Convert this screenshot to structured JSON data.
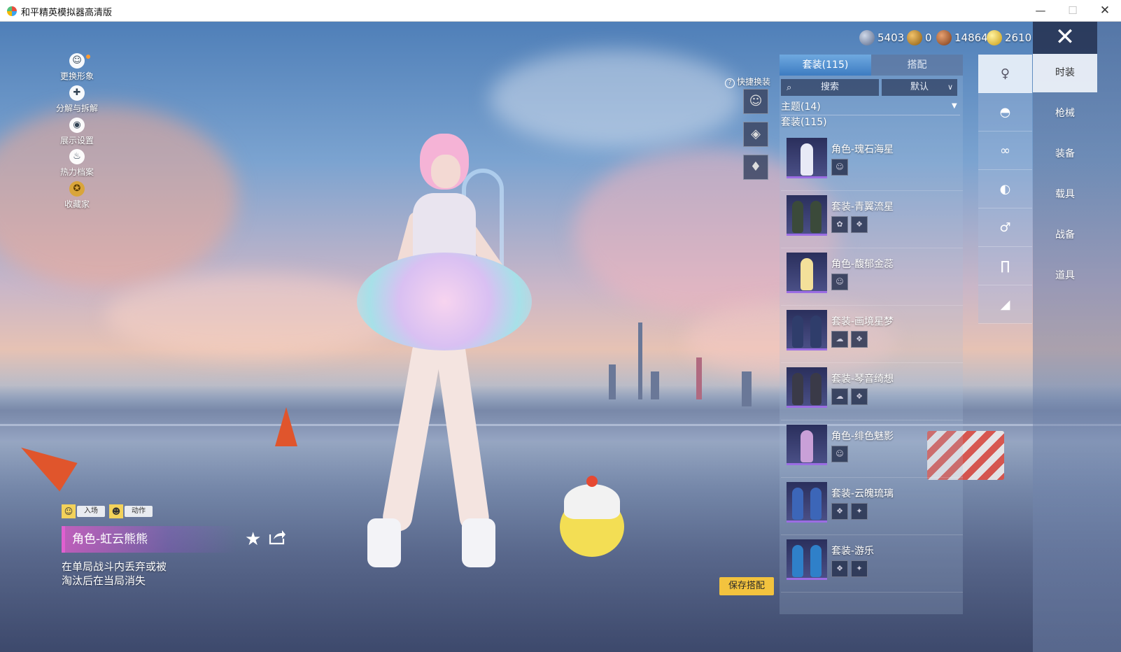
{
  "window": {
    "title": "和平精英模拟器高清版",
    "minimize": "—",
    "maximize": "☐",
    "close": "✕"
  },
  "left_menu": [
    {
      "label": "更换形象",
      "icon": "person-icon",
      "glyph": "☺"
    },
    {
      "label": "分解与拆解",
      "icon": "puzzle-icon",
      "glyph": "✚"
    },
    {
      "label": "展示设置",
      "icon": "eye-icon",
      "glyph": "◉"
    },
    {
      "label": "热力档案",
      "icon": "flame-icon",
      "glyph": "♨"
    },
    {
      "label": "收藏家",
      "icon": "collector-badge-icon",
      "glyph": "✪"
    }
  ],
  "mini_tabs": [
    {
      "label": "入场",
      "glyph": "☺"
    },
    {
      "label": "动作",
      "glyph": "☻"
    }
  ],
  "selected_item": {
    "name": "角色-虹云熊熊",
    "description": "在单局战斗内丢弃或被\n淘汰后在当局消失"
  },
  "save_button": "保存搭配",
  "currencies": [
    {
      "value": "5403",
      "icon": "globe-coin-icon",
      "color": "#8a9bb8"
    },
    {
      "value": "0",
      "icon": "bronze-coin-icon",
      "color": "#c08a2a"
    },
    {
      "value": "14864",
      "icon": "copper-coin-icon",
      "color": "#b06a3a"
    },
    {
      "value": "2610",
      "icon": "gold-coin-icon",
      "color": "#e8c23a"
    }
  ],
  "quick_switch": {
    "label": "快捷换装",
    "help": "?",
    "slots": [
      "☺",
      "◈",
      "♦"
    ]
  },
  "panel": {
    "tab_active": "套装(115)",
    "tab_inactive": "搭配",
    "search": "搜索",
    "sort": "默认",
    "theme_header": "主题(14)",
    "suit_header": "套装(115)"
  },
  "outfits": [
    {
      "name": "角色-瑰石海星",
      "subs": [
        "☺"
      ],
      "color": "#e8eaf6"
    },
    {
      "name": "套装-青翼流星",
      "subs": [
        "✿",
        "❖"
      ],
      "color": "#3b4a3a"
    },
    {
      "name": "角色-馥郁金蕊",
      "subs": [
        "☺"
      ],
      "color": "#f3e09a"
    },
    {
      "name": "套装-画境星梦",
      "subs": [
        "☁",
        "❖"
      ],
      "color": "#2f3d6b"
    },
    {
      "name": "套装-琴音绮想",
      "subs": [
        "☁",
        "❖"
      ],
      "color": "#3a3a48"
    },
    {
      "name": "角色-绯色魅影",
      "subs": [
        "☺"
      ],
      "color": "#c9a0d8"
    },
    {
      "name": "套装-云魄琉璃",
      "subs": [
        "❖",
        "✦"
      ],
      "color": "#3c66b8"
    },
    {
      "name": "套装-游乐",
      "subs": [
        "❖",
        "✦"
      ],
      "color": "#2f80c9"
    }
  ],
  "categories": [
    {
      "name": "outfit-category-icon",
      "glyph": "♀"
    },
    {
      "name": "cap-category-icon",
      "glyph": "◓"
    },
    {
      "name": "glasses-category-icon",
      "glyph": "∞"
    },
    {
      "name": "mask-category-icon",
      "glyph": "◐"
    },
    {
      "name": "top-category-icon",
      "glyph": "♂"
    },
    {
      "name": "pants-category-icon",
      "glyph": "∏"
    },
    {
      "name": "shoes-category-icon",
      "glyph": "◢"
    }
  ],
  "right_tabs": [
    "时装",
    "枪械",
    "装备",
    "载具",
    "战备",
    "道具"
  ],
  "close_label": "✕"
}
